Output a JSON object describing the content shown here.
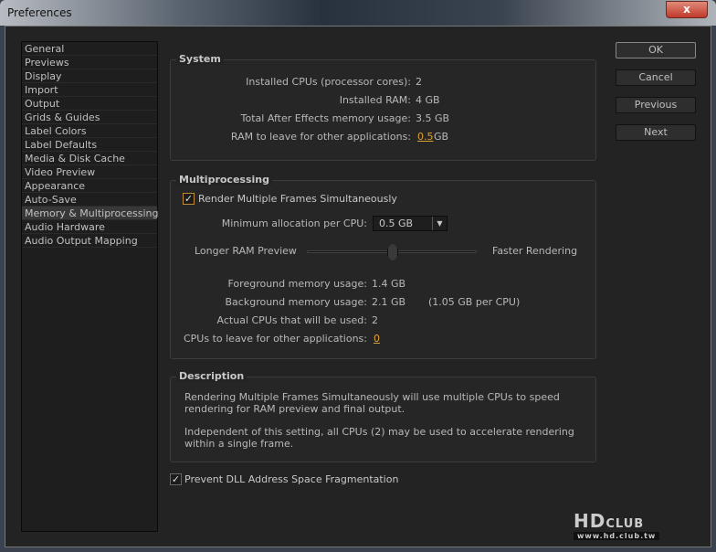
{
  "window": {
    "title": "Preferences",
    "close_label": "x"
  },
  "sidebar": {
    "items": [
      "General",
      "Previews",
      "Display",
      "Import",
      "Output",
      "Grids & Guides",
      "Label Colors",
      "Label Defaults",
      "Media & Disk Cache",
      "Video Preview",
      "Appearance",
      "Auto-Save",
      "Memory & Multiprocessing",
      "Audio Hardware",
      "Audio Output Mapping"
    ],
    "selected": "Memory & Multiprocessing"
  },
  "buttons": {
    "ok": "OK",
    "cancel": "Cancel",
    "previous": "Previous",
    "next": "Next"
  },
  "system": {
    "label": "System",
    "cpus_label": "Installed CPUs (processor cores):",
    "cpus": "2",
    "ram_label": "Installed RAM:",
    "ram": "4 GB",
    "ae_label": "Total After Effects memory usage:",
    "ae": "3.5 GB",
    "leave_label": "RAM to leave for other applications:",
    "leave_value": "0.5",
    "leave_unit": "GB"
  },
  "multi": {
    "label": "Multiprocessing",
    "render_checkbox": "Render Multiple Frames Simultaneously",
    "render_checked": true,
    "min_alloc_label": "Minimum allocation per CPU:",
    "min_alloc_value": "0.5 GB",
    "slider_left": "Longer RAM Preview",
    "slider_right": "Faster Rendering",
    "slider_position": 0.5,
    "fg_label": "Foreground memory usage:",
    "fg": "1.4 GB",
    "bg_label": "Background memory usage:",
    "bg": "2.1 GB",
    "bg_per_cpu": "(1.05 GB per CPU)",
    "actual_label": "Actual CPUs that will be used:",
    "actual": "2",
    "cpus_leave_label": "CPUs to leave for other applications:",
    "cpus_leave": "0"
  },
  "description": {
    "label": "Description",
    "p1": "Rendering Multiple Frames Simultaneously will use multiple CPUs to speed rendering for RAM preview and final output.",
    "p2": "Independent of this setting, all CPUs (2) may be used to accelerate rendering within a single frame."
  },
  "dll_checkbox": {
    "label": "Prevent DLL Address Space Fragmentation",
    "checked": true
  },
  "watermark": {
    "logo": "HDCLUB",
    "url": "www.hd.club.tw"
  }
}
